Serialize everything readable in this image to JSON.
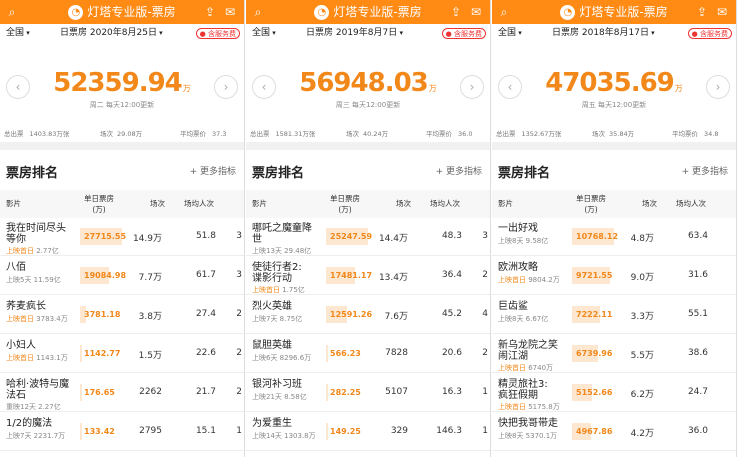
{
  "app_title": "灯塔专业版-票房",
  "icons": {
    "search": "search-icon",
    "share": "share-icon",
    "mail": "mail-icon",
    "logo": "lighthouse-logo-icon"
  },
  "colors": {
    "accent": "#ff8a14",
    "value": "#f2871a"
  },
  "labels": {
    "region": "全国",
    "service_fee": "含服务费",
    "total_box": "总出票",
    "shows": "场次",
    "avg_price": "平均票价",
    "section_title": "票房排名",
    "more_metrics": "+ 更多指标",
    "col_film": "影片",
    "col_box": "单日票房",
    "col_box_unit": "(万)",
    "col_shows": "场次",
    "col_avg_attend": "场均人次",
    "unit": "万",
    "first_day": "上映首日"
  },
  "panels": [
    {
      "date": "日票房 2020年8月25日",
      "total": "52359.94",
      "update": "周二 每天12:00更新",
      "stats": {
        "total_box": "1403.83万张",
        "shows": "29.08万",
        "avg_price": "37.3"
      },
      "rows": [
        {
          "name": "我在时间尽头",
          "name2": "等你",
          "sub": "上映首日 2.77亿",
          "hl": true,
          "box": "27715.55",
          "shows": "14.9万",
          "avg": "51.8",
          "cut": "3",
          "ratio": 1.0
        },
        {
          "name": "八佰",
          "name2": "",
          "sub": "上映5天 11.59亿",
          "hl": false,
          "box": "19084.98",
          "shows": "7.7万",
          "avg": "61.7",
          "cut": "3",
          "ratio": 0.69
        },
        {
          "name": "荞麦疯长",
          "name2": "",
          "sub": "上映首日 3783.4万",
          "hl": true,
          "box": "3781.18",
          "shows": "3.8万",
          "avg": "27.4",
          "cut": "2",
          "ratio": 0.14
        },
        {
          "name": "小妇人",
          "name2": "",
          "sub": "上映首日 1143.1万",
          "hl": true,
          "box": "1142.77",
          "shows": "1.5万",
          "avg": "22.6",
          "cut": "2",
          "ratio": 0.05
        },
        {
          "name": "哈利·波特与魔",
          "name2": "法石",
          "sub": "重映12天 2.27亿",
          "hl": false,
          "box": "176.65",
          "shows": "2262",
          "avg": "21.7",
          "cut": "2",
          "ratio": 0.01
        },
        {
          "name": "1/2的魔法",
          "name2": "",
          "sub": "上映7天 2231.7万",
          "hl": false,
          "box": "133.42",
          "shows": "2795",
          "avg": "15.1",
          "cut": "1",
          "ratio": 0.01
        }
      ]
    },
    {
      "date": "日票房 2019年8月7日",
      "total": "56948.03",
      "update": "周三 每天12:00更新",
      "stats": {
        "total_box": "1581.31万张",
        "shows": "40.24万",
        "avg_price": "36.0"
      },
      "rows": [
        {
          "name": "哪吒之魔童降",
          "name2": "世",
          "sub": "上映13天 29.48亿",
          "hl": false,
          "box": "25247.59",
          "shows": "14.4万",
          "avg": "48.3",
          "cut": "3",
          "ratio": 1.0
        },
        {
          "name": "使徒行者2:",
          "name2": "谍影行动",
          "sub": "上映首日 1.75亿",
          "hl": true,
          "box": "17481.17",
          "shows": "13.4万",
          "avg": "36.4",
          "cut": "2",
          "ratio": 0.69
        },
        {
          "name": "烈火英雄",
          "name2": "",
          "sub": "上映7天 8.75亿",
          "hl": false,
          "box": "12591.26",
          "shows": "7.6万",
          "avg": "45.2",
          "cut": "4",
          "ratio": 0.5
        },
        {
          "name": "鼠胆英雄",
          "name2": "",
          "sub": "上映6天 8296.6万",
          "hl": false,
          "box": "566.23",
          "shows": "7828",
          "avg": "20.6",
          "cut": "2",
          "ratio": 0.02
        },
        {
          "name": "银河补习班",
          "name2": "",
          "sub": "上映21天 8.58亿",
          "hl": false,
          "box": "282.25",
          "shows": "5107",
          "avg": "16.3",
          "cut": "1",
          "ratio": 0.01
        },
        {
          "name": "为爱重生",
          "name2": "",
          "sub": "上映14天 1303.8万",
          "hl": false,
          "box": "149.25",
          "shows": "329",
          "avg": "146.3",
          "cut": "1",
          "ratio": 0.01
        }
      ]
    },
    {
      "date": "日票房 2018年8月17日",
      "total": "47035.69",
      "update": "周五 每天12:00更新",
      "stats": {
        "total_box": "1352.67万张",
        "shows": "35.84万",
        "avg_price": "34.8"
      },
      "rows": [
        {
          "name": "一出好戏",
          "name2": "",
          "sub": "上映8天 9.58亿",
          "hl": false,
          "box": "10768.12",
          "shows": "4.8万",
          "avg": "63.4",
          "cut": "",
          "ratio": 1.0
        },
        {
          "name": "欧洲攻略",
          "name2": "",
          "sub": "上映首日 9804.2万",
          "hl": true,
          "box": "9721.55",
          "shows": "9.0万",
          "avg": "31.6",
          "cut": "",
          "ratio": 0.9
        },
        {
          "name": "巨齿鲨",
          "name2": "",
          "sub": "上映8天 6.67亿",
          "hl": false,
          "box": "7222.11",
          "shows": "3.3万",
          "avg": "55.1",
          "cut": "",
          "ratio": 0.67
        },
        {
          "name": "新乌龙院之笑",
          "name2": "闹江湖",
          "sub": "上映首日 6740万",
          "hl": true,
          "box": "6739.96",
          "shows": "5.5万",
          "avg": "38.6",
          "cut": "",
          "ratio": 0.63
        },
        {
          "name": "精灵旅社3:",
          "name2": "疯狂假期",
          "sub": "上映首日 5175.8万",
          "hl": true,
          "box": "5152.66",
          "shows": "6.2万",
          "avg": "24.7",
          "cut": "",
          "ratio": 0.48
        },
        {
          "name": "快把我哥带走",
          "name2": "",
          "sub": "上映8天 5370.1万",
          "hl": false,
          "box": "4967.86",
          "shows": "4.2万",
          "avg": "36.0",
          "cut": "",
          "ratio": 0.46
        }
      ]
    }
  ]
}
